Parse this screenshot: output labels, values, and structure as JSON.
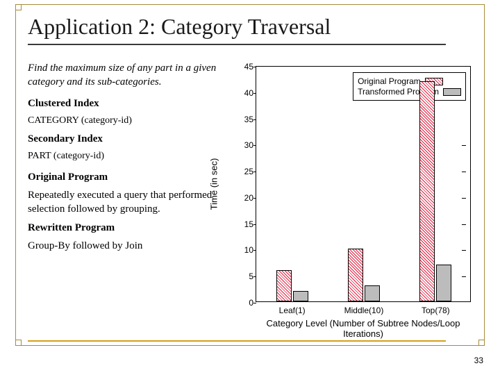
{
  "title": "Application 2: Category Traversal",
  "intro": "Find the maximum size of any part in a given category and its sub-categories.",
  "indexes": {
    "clustered_heading": "Clustered Index",
    "clustered_body": "CATEGORY (category-id)",
    "secondary_heading": "Secondary Index",
    "secondary_body": "PART (category-id)"
  },
  "programs": {
    "orig_heading": "Original Program",
    "orig_body": "Repeatedly executed a query that performed selection followed by grouping.",
    "rewr_heading": "Rewritten Program",
    "rewr_body": "Group-By followed by Join"
  },
  "page_number": "33",
  "chart_data": {
    "type": "bar",
    "categories": [
      "Leaf(1)",
      "Middle(10)",
      "Top(78)"
    ],
    "series": [
      {
        "name": "Original Program",
        "values": [
          6,
          10,
          42
        ],
        "pattern": "crosshatch-red"
      },
      {
        "name": "Transformed Program",
        "values": [
          2,
          3,
          7
        ],
        "pattern": "solid-gray"
      }
    ],
    "xlabel": "Category Level (Number of Subtree Nodes/Loop Iterations)",
    "ylabel": "Time (in sec)",
    "ylim": [
      0,
      45
    ],
    "yticks": [
      0,
      5,
      10,
      15,
      20,
      25,
      30,
      35,
      40,
      45
    ],
    "legend_position": "top-right"
  }
}
